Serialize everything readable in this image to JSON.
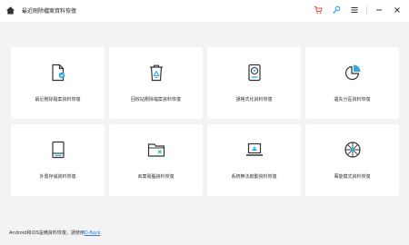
{
  "titlebar": {
    "title": "最近刪除檔案資料恢復",
    "icons": [
      "home-icon",
      "cart-icon",
      "key-icon",
      "menu-icon",
      "minimize-icon",
      "close-icon"
    ]
  },
  "colors": {
    "accent": "#2ea8e0",
    "danger": "#e74c3c",
    "text": "#333333",
    "link": "#2b7de9"
  },
  "cards": [
    {
      "label": "最近刪除檔案資料恢復",
      "icon": "document-recovery-icon"
    },
    {
      "label": "回收站刪除檔案資料恢復",
      "icon": "recycle-bin-icon"
    },
    {
      "label": "誤格式化資料恢復",
      "icon": "hard-drive-icon"
    },
    {
      "label": "遺失分區資料恢復",
      "icon": "pie-partition-icon"
    },
    {
      "label": "外置存儲資料恢復",
      "icon": "external-storage-icon"
    },
    {
      "label": "丟棄電腦資料恢復",
      "icon": "folder-x-icon"
    },
    {
      "label": "系統無法啟動資料恢復",
      "icon": "laptop-warning-icon"
    },
    {
      "label": "萬能模式資料恢復",
      "icon": "wheel-icon"
    }
  ],
  "footer": {
    "text": "Android和iOS設備資料恢復，請使用",
    "link": "D-Back"
  }
}
